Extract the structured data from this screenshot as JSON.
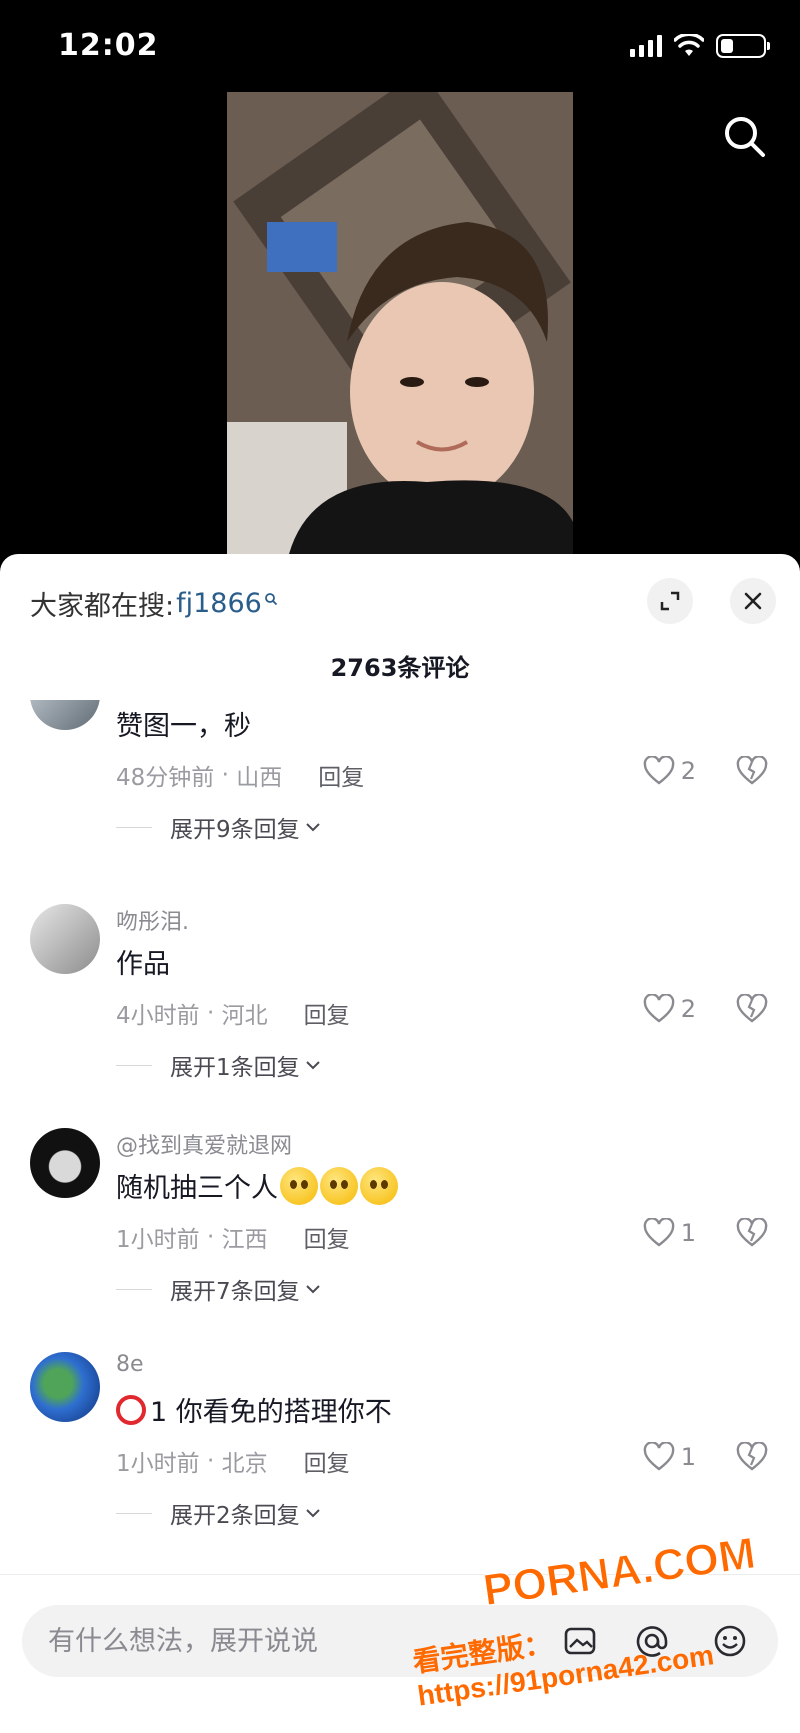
{
  "status_bar": {
    "time": "12:02"
  },
  "trending": {
    "label": "大家都在搜:",
    "term": "fj1866"
  },
  "comment_count": "2763条评论",
  "comments": [
    {
      "username": "",
      "text": "赞图一，秒",
      "time": "48分钟前",
      "location": "山西",
      "reply_label": "回复",
      "likes": "2",
      "expand_label": "展开9条回复"
    },
    {
      "username": "吻彤泪.",
      "text": "作品",
      "time": "4小时前",
      "location": "河北",
      "reply_label": "回复",
      "likes": "2",
      "expand_label": "展开1条回复"
    },
    {
      "username": "@找到真爱就退网",
      "text": "随机抽三个人",
      "time": "1小时前",
      "location": "江西",
      "reply_label": "回复",
      "likes": "1",
      "expand_label": "展开7条回复"
    },
    {
      "username": "8e",
      "text": "1 你看免的搭理你不",
      "time": "1小时前",
      "location": "北京",
      "reply_label": "回复",
      "likes": "1",
      "expand_label": "展开2条回复"
    }
  ],
  "input": {
    "placeholder": "有什么想法，展开说说"
  },
  "watermark": {
    "brand": "PORNA.COM",
    "url": "看完整版：https://91porna42.com"
  }
}
